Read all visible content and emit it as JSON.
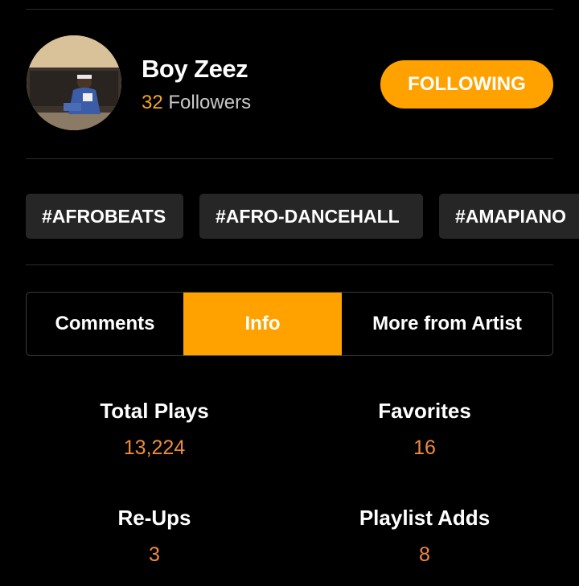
{
  "artist": {
    "name": "Boy Zeez",
    "followers_count": "32",
    "followers_label": "Followers",
    "follow_button_label": "FOLLOWING"
  },
  "tags": [
    "#AFROBEATS",
    "#AFRO-DANCEHALL",
    "#AMAPIANO"
  ],
  "tabs": [
    {
      "label": "Comments",
      "active": false
    },
    {
      "label": "Info",
      "active": true
    },
    {
      "label": "More from Artist",
      "active": false
    }
  ],
  "stats": {
    "total_plays": {
      "label": "Total Plays",
      "value": "13,224"
    },
    "favorites": {
      "label": "Favorites",
      "value": "16"
    },
    "reups": {
      "label": "Re-Ups",
      "value": "3"
    },
    "playlist_adds": {
      "label": "Playlist Adds",
      "value": "8"
    }
  },
  "colors": {
    "accent": "#ffa200",
    "stat_value": "#f08a3c",
    "background": "#000000",
    "tag_background": "#262626"
  }
}
